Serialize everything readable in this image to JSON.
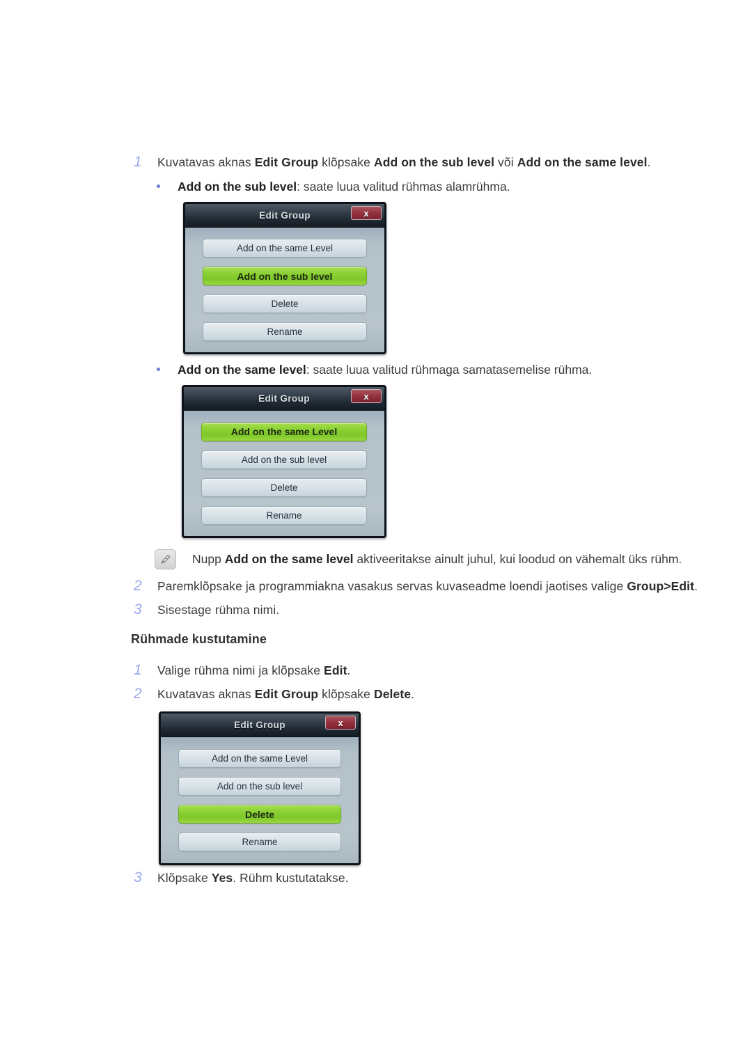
{
  "steps_top": [
    {
      "num": "1",
      "html": "Kuvatavas aknas <b>Edit Group</b> klõpsake <b>Add on the sub level</b> või <b>Add on the same level</b>."
    }
  ],
  "bullets": [
    {
      "html": "<b>Add on the sub level</b>: saate luua valitud rühmas alamrühma."
    },
    {
      "html": "<b>Add on the same level</b>: saate luua valitud rühmaga samatasemelise rühma."
    }
  ],
  "note": {
    "icon": "note-pencil-icon",
    "html": "Nupp <b>Add on the same level</b> aktiveeritakse ainult juhul, kui loodud on vähemalt üks rühm."
  },
  "steps_mid": [
    {
      "num": "2",
      "html": "Paremklõpsake ja programmiakna vasakus servas kuvaseadme loendi jaotises valige <b>Group&gt;Edit</b>."
    },
    {
      "num": "3",
      "html": "Sisestage rühma nimi."
    }
  ],
  "section": {
    "heading": "Rühmade kustutamine"
  },
  "steps_delete": [
    {
      "num": "1",
      "html": "Valige rühma nimi ja klõpsake <b>Edit</b>."
    },
    {
      "num": "2",
      "html": "Kuvatavas aknas <b>Edit Group</b> klõpsake <b>Delete</b>."
    }
  ],
  "steps_end": [
    {
      "num": "3",
      "html": "Klõpsake <b>Yes</b>. Rühm kustutatakse."
    }
  ],
  "dialogs": [
    {
      "id": "dialog-sub-level",
      "title": "Edit Group",
      "close_label": "x",
      "buttons": [
        {
          "label": "Add on the same Level",
          "selected": false
        },
        {
          "label": "Add on the sub level",
          "selected": true
        },
        {
          "label": "Delete",
          "selected": false
        },
        {
          "label": "Rename",
          "selected": false
        }
      ]
    },
    {
      "id": "dialog-same-level",
      "title": "Edit Group",
      "close_label": "x",
      "buttons": [
        {
          "label": "Add on the same Level",
          "selected": true
        },
        {
          "label": "Add on the sub level",
          "selected": false
        },
        {
          "label": "Delete",
          "selected": false
        },
        {
          "label": "Rename",
          "selected": false
        }
      ]
    },
    {
      "id": "dialog-delete",
      "title": "Edit Group",
      "close_label": "x",
      "buttons": [
        {
          "label": "Add on the same Level",
          "selected": false
        },
        {
          "label": "Add on the sub level",
          "selected": false
        },
        {
          "label": "Delete",
          "selected": true
        },
        {
          "label": "Rename",
          "selected": false
        }
      ]
    }
  ],
  "colors": {
    "step_number": "#9aa9ea",
    "bullet": "#6b7fd0",
    "selected_green": "#8ad033",
    "close_red": "#96323f",
    "dialog_body": "#b8c4cb",
    "titlebar_dark": "#232d38",
    "text": "#3b3b3b"
  }
}
